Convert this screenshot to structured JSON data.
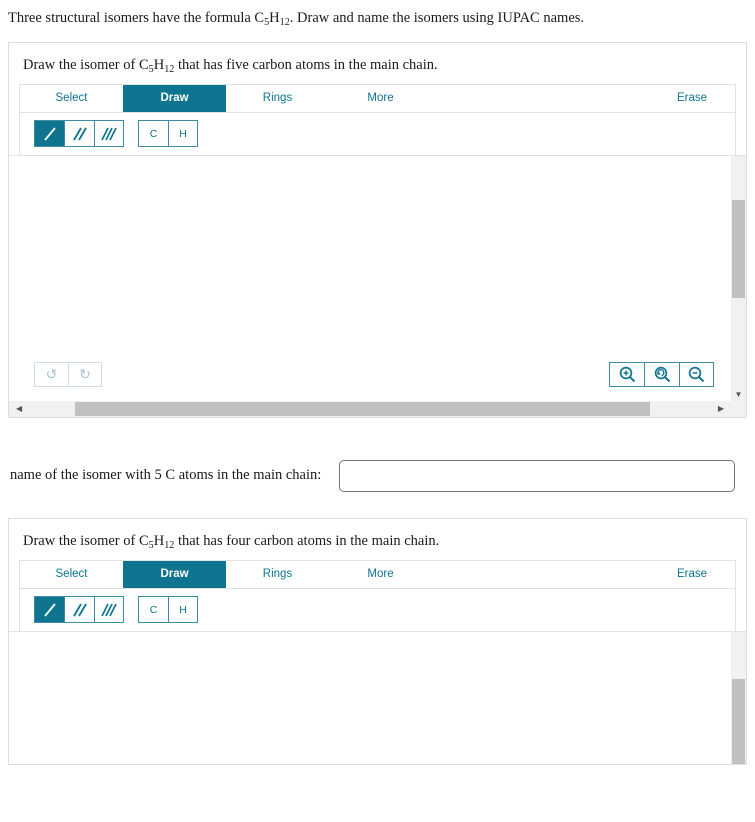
{
  "prompt": {
    "before_formula": "Three structural isomers have the formula ",
    "formula_c": "C",
    "formula_c_sub": "5",
    "formula_h": "H",
    "formula_h_sub": "12",
    "after_formula": ". Draw and name the isomers using IUPAC names."
  },
  "editors": [
    {
      "heading_before": "Draw the isomer of ",
      "heading_c": "C",
      "heading_c_sub": "5",
      "heading_h": "H",
      "heading_h_sub": "12",
      "heading_after": " that has five carbon atoms in the main chain.",
      "tabs": [
        {
          "label": "Select",
          "active": false
        },
        {
          "label": "Draw",
          "active": true
        },
        {
          "label": "Rings",
          "active": false
        },
        {
          "label": "More",
          "active": false
        }
      ],
      "erase_label": "Erase",
      "bond_tools": [
        {
          "name": "single-bond-tool",
          "icon": "single-bond-icon",
          "selected": true
        },
        {
          "name": "double-bond-tool",
          "icon": "double-bond-icon",
          "selected": false
        },
        {
          "name": "triple-bond-tool",
          "icon": "triple-bond-icon",
          "selected": false
        }
      ],
      "atom_tools": [
        {
          "name": "carbon-atom-tool",
          "label": "C"
        },
        {
          "name": "hydrogen-atom-tool",
          "label": "H"
        }
      ],
      "history_tools": [
        {
          "name": "undo-button",
          "glyph": "↺"
        },
        {
          "name": "redo-button",
          "glyph": "↻"
        }
      ],
      "zoom_tools": [
        {
          "name": "zoom-in-button",
          "icon": "zoom-in-icon"
        },
        {
          "name": "zoom-reset-button",
          "icon": "zoom-reset-icon"
        },
        {
          "name": "zoom-out-button",
          "icon": "zoom-out-icon"
        }
      ]
    },
    {
      "heading_before": "Draw the isomer of ",
      "heading_c": "C",
      "heading_c_sub": "5",
      "heading_h": "H",
      "heading_h_sub": "12",
      "heading_after": " that has four carbon atoms in the main chain.",
      "tabs": [
        {
          "label": "Select",
          "active": false
        },
        {
          "label": "Draw",
          "active": true
        },
        {
          "label": "Rings",
          "active": false
        },
        {
          "label": "More",
          "active": false
        }
      ],
      "erase_label": "Erase",
      "bond_tools": [
        {
          "name": "single-bond-tool",
          "icon": "single-bond-icon",
          "selected": true
        },
        {
          "name": "double-bond-tool",
          "icon": "double-bond-icon",
          "selected": false
        },
        {
          "name": "triple-bond-tool",
          "icon": "triple-bond-icon",
          "selected": false
        }
      ],
      "atom_tools": [
        {
          "name": "carbon-atom-tool",
          "label": "C"
        },
        {
          "name": "hydrogen-atom-tool",
          "label": "H"
        }
      ]
    }
  ],
  "answer": {
    "label": "name of the isomer with 5 C atoms in the main chain:",
    "value": "",
    "placeholder": ""
  },
  "colors": {
    "accent_teal": "#0e7490",
    "tool_border": "#3d8ea3",
    "panel_border": "#dddddd",
    "scroll_track": "#f1f1f1",
    "scroll_thumb": "#c0c0c0",
    "disabled_icon": "#a8c6cf"
  },
  "scroll": {
    "vertical_thumb_top_pct": 18,
    "vertical_thumb_height_pct": 40,
    "horizontal_thumb_left_pct": 9,
    "horizontal_thumb_width_pct": 78
  }
}
